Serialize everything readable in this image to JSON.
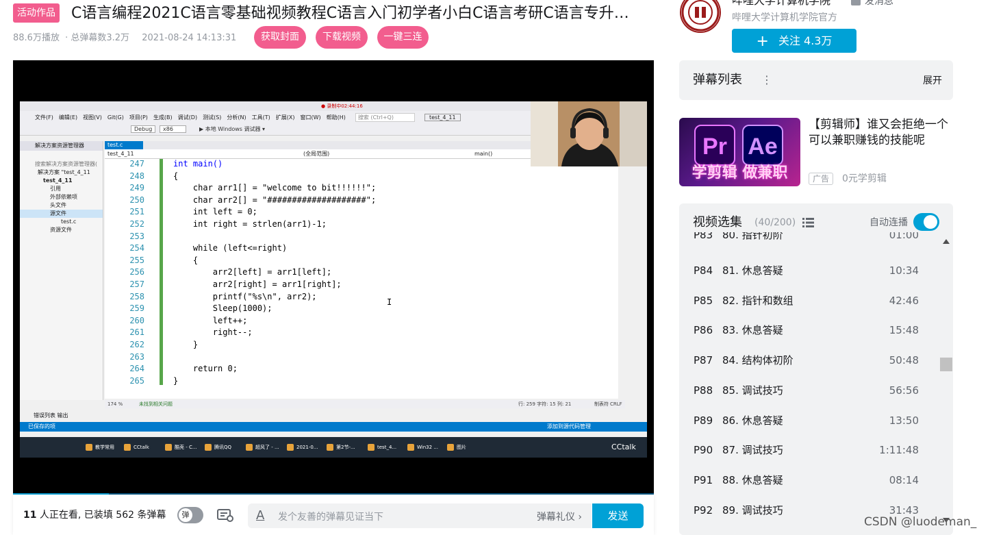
{
  "header": {
    "activity_badge": "活动作品",
    "title": "C语言编程2021C语言零基础视频教程C语言入门初学者小白C语言考研C语言专升…",
    "plays": "88.6万播放",
    "danmaku_total": "· 总弹幕数3.2万",
    "date": "2021-08-24 14:13:31",
    "buttons": [
      "获取封面",
      "下载视频",
      "一键三连"
    ]
  },
  "player": {
    "screen": {
      "menu": [
        "文件(F)",
        "编辑(E)",
        "视图(V)",
        "Git(G)",
        "项目(P)",
        "生成(B)",
        "调试(D)",
        "测试(S)",
        "分析(N)",
        "工具(T)",
        "扩展(X)",
        "窗口(W)",
        "帮助(H)"
      ],
      "search_placeholder": "搜索 (Ctrl+Q)",
      "project_badge": "test_4_11",
      "debug_config": "Debug",
      "platform": "x86",
      "run_label": "▶ 本地 Windows 调试器 ▾",
      "recording": "● 录制中02:44:16",
      "solution_explorer_title": "解决方案资源管理器",
      "solution_search": "搜索解决方案资源管理器(",
      "tree": [
        "解决方案 \"test_4_11",
        "test_4_11",
        "引用",
        "外部依赖项",
        "头文件",
        "源文件",
        "test.c",
        "资源文件"
      ],
      "active_tab": "test.c",
      "nav_left": "test_4_11",
      "nav_mid": "(全局范围)",
      "nav_right": "main()",
      "line_numbers": [
        "247",
        "248",
        "249",
        "250",
        "251",
        "252",
        "253",
        "254",
        "255",
        "256",
        "257",
        "258",
        "259",
        "260",
        "261",
        "262",
        "263",
        "264",
        "265"
      ],
      "code": [
        "int main()",
        "{",
        "    char arr1[] = \"welcome to bit!!!!!!\";",
        "    char arr2[] = \"####################\";",
        "    int left = 0;",
        "    int right = strlen(arr1)-1;",
        "",
        "    while (left<=right)",
        "    {",
        "        arr2[left] = arr1[left];",
        "        arr2[right] = arr1[right];",
        "        printf(\"%s\\n\", arr2);",
        "        Sleep(1000);",
        "        left++;",
        "        right--;",
        "    }",
        "",
        "    return 0;",
        "}"
      ],
      "zoom": "174 %",
      "status_ok": "未找到相关问题",
      "cursor_pos": "行: 259    字符: 15    列: 21",
      "tab_mode": "制表符",
      "eol": "CRLF",
      "output_tabs": "错误列表  输出",
      "saved": "已保存的项",
      "add_to_source": "添加到源代码管理",
      "taskbar_items": [
        "教学常用",
        "CCtalk",
        "酷壳 - C...",
        "腾讯QQ",
        "超风了 - ...",
        "2021-0...",
        "第2节-...",
        "test_4...",
        "Win32 ...",
        "图片"
      ],
      "cctalk_watermark": "CCtalk"
    }
  },
  "bottom_bar": {
    "viewers_count": "11",
    "viewers_text": " 人正在看, 已装填 562 条弹幕",
    "danmaku_toggle_label": "弹",
    "input_icon": "A",
    "input_placeholder": "发个友善的弹幕见证当下",
    "etiquette": "弹幕礼仪 ›",
    "send": "发送"
  },
  "uploader": {
    "name": "哔哩大学计算机学院",
    "message": "发消息",
    "description": "哔哩大学计算机学院官方",
    "follow": "关注 4.3万",
    "follow_icon": "+"
  },
  "danmaku_list": {
    "title": "弹幕列表",
    "menu_icon": "⋮",
    "expand": "展开"
  },
  "ad": {
    "pr": "Pr",
    "ae": "Ae",
    "caption": "学剪辑 做兼职",
    "title": "【剪辑师】谁又会拒绝一个可以兼职赚钱的技能呢",
    "tag": "广告",
    "price": "0元学剪辑"
  },
  "episodes": {
    "title": "视频选集",
    "count": "(40/200)",
    "autoplay_label": "自动连播",
    "items": [
      {
        "p": "P83",
        "title": "80. 指针初阶",
        "duration": "01:00"
      },
      {
        "p": "P84",
        "title": "81. 休息答疑",
        "duration": "10:34"
      },
      {
        "p": "P85",
        "title": "82. 指针和数组",
        "duration": "42:46"
      },
      {
        "p": "P86",
        "title": "83. 休息答疑",
        "duration": "15:48"
      },
      {
        "p": "P87",
        "title": "84. 结构体初阶",
        "duration": "50:48"
      },
      {
        "p": "P88",
        "title": "85. 调试技巧",
        "duration": "56:56"
      },
      {
        "p": "P89",
        "title": "86. 休息答疑",
        "duration": "13:50"
      },
      {
        "p": "P90",
        "title": "87. 调试技巧",
        "duration": "1:11:48"
      },
      {
        "p": "P91",
        "title": "88. 休息答疑",
        "duration": "08:14"
      },
      {
        "p": "P92",
        "title": "89. 调试技巧",
        "duration": "31:43"
      }
    ]
  },
  "watermark": "CSDN @luodeman_",
  "colors": {
    "pink_accent": "#f25d8e",
    "blue_accent": "#00a1d6",
    "panel_bg": "#f1f2f3"
  }
}
